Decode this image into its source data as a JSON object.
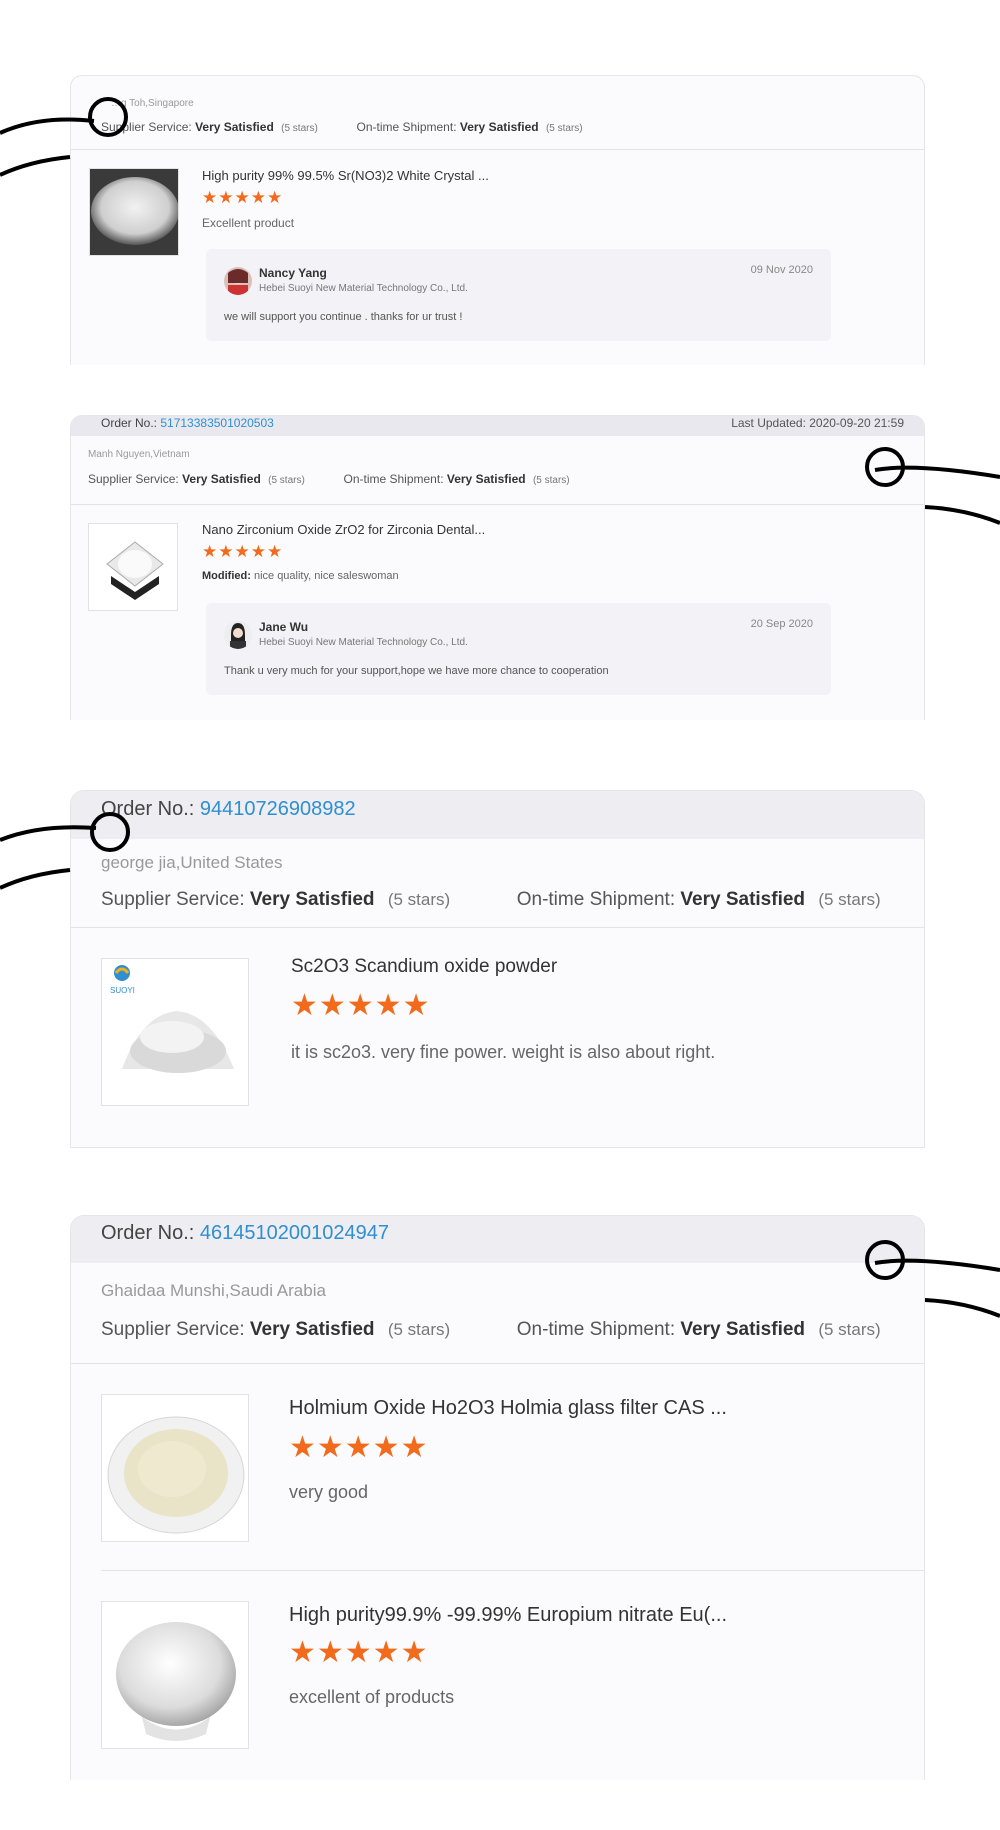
{
  "reviews": [
    {
      "reviewer": "…g Toh,Singapore",
      "supplier_label": "Supplier Service:",
      "supplier_value": "Very Satisfied",
      "supplier_stars": "(5 stars)",
      "ship_label": "On-time Shipment:",
      "ship_value": "Very Satisfied",
      "ship_stars": "(5 stars)",
      "products": [
        {
          "title": "High purity 99% 99.5% Sr(NO3)2 White Crystal ...",
          "stars": "★★★★★",
          "comment": "Excellent product"
        }
      ],
      "reply": {
        "name": "Nancy Yang",
        "company": "Hebei Suoyi New Material Technology Co., Ltd.",
        "date": "09 Nov 2020",
        "text": "we will support you continue . thanks for ur trust !"
      }
    },
    {
      "order_label": "Order No.:",
      "order_no": "51713383501020503",
      "updated": "Last Updated: 2020-09-20 21:59",
      "reviewer": "Manh Nguyen,Vietnam",
      "supplier_label": "Supplier Service:",
      "supplier_value": "Very Satisfied",
      "supplier_stars": "(5 stars)",
      "ship_label": "On-time Shipment:",
      "ship_value": "Very Satisfied",
      "ship_stars": "(5 stars)",
      "products": [
        {
          "title": "Nano Zirconium Oxide ZrO2 for Zirconia Dental...",
          "stars": "★★★★★",
          "comment_label": "Modified:",
          "comment": "nice quality, nice saleswoman"
        }
      ],
      "reply": {
        "name": "Jane Wu",
        "company": "Hebei Suoyi New Material Technology Co., Ltd.",
        "date": "20 Sep 2020",
        "text": "Thank u very much for your support,hope we have more chance to cooperation"
      }
    },
    {
      "order_label": "Order No.:",
      "order_no": "94410726908982",
      "reviewer": "george jia,United States",
      "supplier_label": "Supplier Service:",
      "supplier_value": "Very Satisfied",
      "supplier_stars": "(5 stars)",
      "ship_label": "On-time Shipment:",
      "ship_value": "Very Satisfied",
      "ship_stars": "(5 stars)",
      "products": [
        {
          "title": "Sc2O3 Scandium oxide powder",
          "stars": "★★★★★",
          "comment": "it is sc2o3. very fine power. weight is also about right.",
          "brand": "SUOYI"
        }
      ]
    },
    {
      "order_label": "Order No.:",
      "order_no": "46145102001024947",
      "reviewer": "Ghaidaa Munshi,Saudi Arabia",
      "supplier_label": "Supplier Service:",
      "supplier_value": "Very Satisfied",
      "supplier_stars": "(5 stars)",
      "ship_label": "On-time Shipment:",
      "ship_value": "Very Satisfied",
      "ship_stars": "(5 stars)",
      "products": [
        {
          "title": "Holmium Oxide Ho2O3 Holmia glass filter CAS ...",
          "stars": "★★★★★",
          "comment": "very good"
        },
        {
          "title": "High purity99.9% -99.99% Europium nitrate Eu(...",
          "stars": "★★★★★",
          "comment": "excellent of products"
        }
      ]
    }
  ],
  "colors": {
    "accent_blue": "#2f8fd0",
    "star_orange": "#f26b1d"
  }
}
